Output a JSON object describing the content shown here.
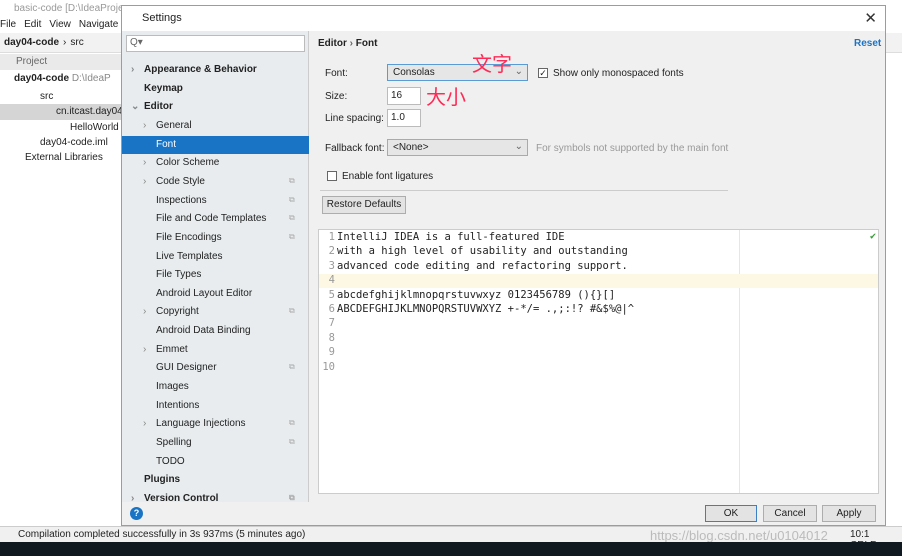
{
  "ide": {
    "title": "basic-code [D:\\IdeaProje",
    "menu": [
      "File",
      "Edit",
      "View",
      "Navigate"
    ],
    "crumbs": [
      "day04-code",
      "src"
    ],
    "project_label": "Project",
    "tree": [
      {
        "label": "day04-code",
        "extra": "D:\\IdeaP",
        "depth": 0
      },
      {
        "label": "src",
        "depth": 1
      },
      {
        "label": "cn.itcast.day04.",
        "depth": 2
      },
      {
        "label": "HelloWorld",
        "depth": 3
      },
      {
        "label": "day04-code.iml",
        "depth": 1
      },
      {
        "label": "External Libraries",
        "depth": 0
      }
    ],
    "status": "Compilation completed successfully in 3s 937ms (5 minutes ago)",
    "status_right": "10:1  CRLF÷",
    "watermark": "https://blog.csdn.net/u0104012"
  },
  "dialog": {
    "title": "Settings",
    "search_placeholder": "Q▾",
    "sidebar": [
      {
        "label": "Appearance & Behavior",
        "level": 0,
        "bold": true,
        "chevron": ">"
      },
      {
        "label": "Keymap",
        "level": 0,
        "bold": true
      },
      {
        "label": "Editor",
        "level": 0,
        "bold": true,
        "chevron": "v"
      },
      {
        "label": "General",
        "level": 1,
        "chevron": ">"
      },
      {
        "label": "Font",
        "level": 1,
        "selected": true
      },
      {
        "label": "Color Scheme",
        "level": 1,
        "chevron": ">"
      },
      {
        "label": "Code Style",
        "level": 1,
        "chevron": ">",
        "copy": true
      },
      {
        "label": "Inspections",
        "level": 1,
        "copy": true
      },
      {
        "label": "File and Code Templates",
        "level": 1,
        "copy": true
      },
      {
        "label": "File Encodings",
        "level": 1,
        "copy": true
      },
      {
        "label": "Live Templates",
        "level": 1
      },
      {
        "label": "File Types",
        "level": 1
      },
      {
        "label": "Android Layout Editor",
        "level": 1
      },
      {
        "label": "Copyright",
        "level": 1,
        "chevron": ">",
        "copy": true
      },
      {
        "label": "Android Data Binding",
        "level": 1
      },
      {
        "label": "Emmet",
        "level": 1,
        "chevron": ">"
      },
      {
        "label": "GUI Designer",
        "level": 1,
        "copy": true
      },
      {
        "label": "Images",
        "level": 1
      },
      {
        "label": "Intentions",
        "level": 1
      },
      {
        "label": "Language Injections",
        "level": 1,
        "chevron": ">",
        "copy": true
      },
      {
        "label": "Spelling",
        "level": 1,
        "copy": true
      },
      {
        "label": "TODO",
        "level": 1
      },
      {
        "label": "Plugins",
        "level": 0,
        "bold": true
      },
      {
        "label": "Version Control",
        "level": 0,
        "bold": true,
        "chevron": ">",
        "copy": true
      }
    ],
    "breadcrumb": {
      "parent": "Editor",
      "sep": "›",
      "current": "Font"
    },
    "reset": "Reset",
    "font_label": "Font:",
    "font_value": "Consolas",
    "mono_only": {
      "label": "Show only monospaced fonts",
      "checked": true
    },
    "size_label": "Size:",
    "size_value": "16",
    "spacing_label": "Line spacing:",
    "spacing_value": "1.0",
    "fallback_label": "Fallback font:",
    "fallback_value": "<None>",
    "fallback_hint": "For symbols not supported by the main font",
    "ligatures": {
      "label": "Enable font ligatures",
      "checked": false
    },
    "restore": "Restore Defaults",
    "preview": [
      "IntelliJ IDEA is a full-featured IDE",
      "with a high level of usability and outstanding",
      "advanced code editing and refactoring support.",
      "",
      "abcdefghijklmnopqrstuvwxyz 0123456789 (){}[]",
      "ABCDEFGHIJKLMNOPQRSTUVWXYZ +-*/= .,;:!? #&$%@|^",
      "",
      "",
      "",
      ""
    ],
    "annotations": {
      "font": "文字",
      "size": "大小"
    },
    "buttons": {
      "ok": "OK",
      "cancel": "Cancel",
      "apply": "Apply"
    },
    "colors": {
      "accent": "#1a74c6",
      "annotation": "#ff2a55"
    }
  }
}
